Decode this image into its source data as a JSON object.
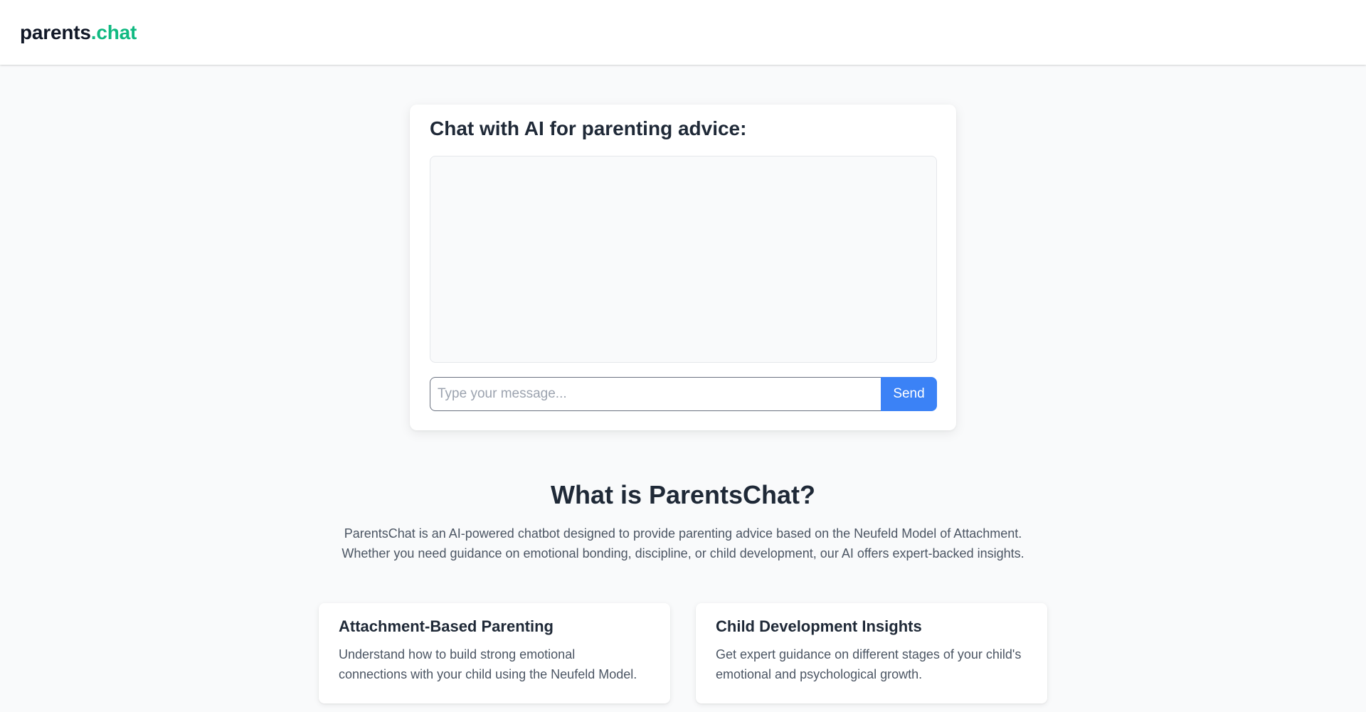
{
  "header": {
    "logo_main": "parents",
    "logo_accent": ".chat"
  },
  "chat": {
    "title": "Chat with AI for parenting advice:",
    "input_placeholder": "Type your message...",
    "input_value": "",
    "send_label": "Send"
  },
  "about": {
    "title": "What is ParentsChat?",
    "line1": "ParentsChat is an AI-powered chatbot designed to provide parenting advice based on the Neufeld Model of Attachment.",
    "line2": "Whether you need guidance on emotional bonding, discipline, or child development, our AI offers expert-backed insights."
  },
  "features": [
    {
      "title": "Attachment-Based Parenting",
      "desc_line1": "Understand how to build strong emotional",
      "desc_line2": "connections with your child using the Neufeld Model."
    },
    {
      "title": "Child Development Insights",
      "desc_line1": "Get expert guidance on different stages of your child's",
      "desc_line2": "emotional and psychological growth."
    }
  ],
  "colors": {
    "accent_green": "#10b981",
    "button_blue": "#3b82f6",
    "page_background": "#f9fafb"
  }
}
